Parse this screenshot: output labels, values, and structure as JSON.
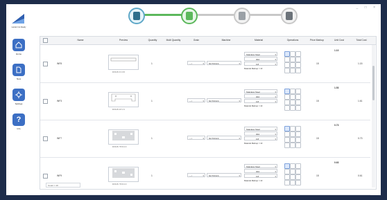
{
  "window": {
    "controls": "_ □ ×"
  },
  "sidebar": {
    "logo_text": "Lantek Cut Ready",
    "items": [
      {
        "label": "Home",
        "icon": "home-icon"
      },
      {
        "label": "New",
        "icon": "file-icon"
      },
      {
        "label": "Settings",
        "icon": "settings-icon"
      },
      {
        "label": "Info",
        "icon": "question-icon"
      }
    ]
  },
  "stepper": {
    "steps": [
      {
        "icon": "part-icon",
        "state": "done",
        "color": "#5fa8c8"
      },
      {
        "icon": "list-icon",
        "state": "active",
        "color": "#5cb85c"
      },
      {
        "icon": "nest-icon",
        "state": "pending",
        "color": "#c8c8c8"
      },
      {
        "icon": "price-icon",
        "state": "pending",
        "color": "#c8c8c8"
      }
    ]
  },
  "table": {
    "headers": [
      "Name",
      "Preview",
      "Quantity",
      "Multi Quantity",
      "Grain",
      "Machine",
      "Material",
      "Operations",
      "Price Markup",
      "Unit Cost",
      "Total Cost"
    ],
    "rows": [
      {
        "name": "INF8",
        "preview": "DXF-B 0 3 0 8",
        "quantity": "1",
        "grain": "↔↕",
        "machine": "NCTOOLS",
        "mat_type": "Stainless Steel",
        "mat_grade": "304",
        "mat_thick": "0.8",
        "markup": "Material Markup = 10",
        "price_markup": "15",
        "unit_cost": "1.10",
        "total_cost": "1.15"
      },
      {
        "name": "INF3",
        "preview": "DXF-B 0 8 1 6",
        "quantity": "1",
        "grain": "↔↕",
        "machine": "NCTOOLS",
        "mat_type": "Stainless Steel",
        "mat_grade": "304",
        "mat_thick": "0.8",
        "markup": "Material Markup = 10",
        "price_markup": "15",
        "unit_cost": "1.53",
        "total_cost": "1.61"
      },
      {
        "name": "INF7",
        "preview": "DXF-B 7 B 8 2 0",
        "quantity": "1",
        "grain": "↔↕",
        "machine": "NCTOOLS",
        "mat_type": "Stainless Steel",
        "mat_grade": "304",
        "mat_thick": "0.8",
        "markup": "Material Markup = 10",
        "price_markup": "15",
        "unit_cost": "0.73",
        "total_cost": "0.73"
      },
      {
        "name": "INF9",
        "preview": "DXF-B 7 B 8 2 0",
        "quantity": "1",
        "grain": "↔↕",
        "machine": "NCTOOLS",
        "mat_type": "Stainless Steel",
        "mat_grade": "304",
        "mat_thick": "0.8",
        "markup": "Material Markup = 10",
        "price_markup": "15",
        "unit_cost": "0.63",
        "total_cost": "0.61"
      }
    ],
    "footer": "Count = 10"
  }
}
